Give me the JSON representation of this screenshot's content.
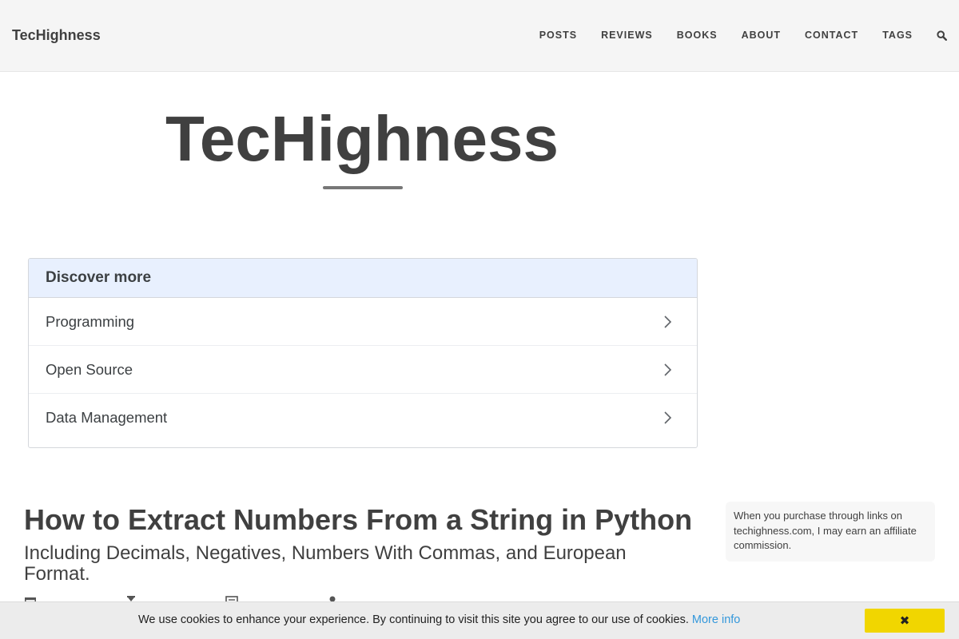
{
  "header": {
    "brand": "TecHighness",
    "nav": [
      "POSTS",
      "REVIEWS",
      "BOOKS",
      "ABOUT",
      "CONTACT",
      "TAGS"
    ],
    "search_icon": "search-icon"
  },
  "hero": {
    "title": "TecHighness"
  },
  "discover": {
    "heading": "Discover more",
    "items": [
      "Programming",
      "Open Source",
      "Data Management"
    ],
    "item_icon": "chevron-right-icon"
  },
  "post": {
    "title": "How to Extract Numbers From a String in Python",
    "subtitle": "Including Decimals, Negatives, Numbers With Commas, and European Format.",
    "meta_icons": [
      "calendar-icon",
      "hourglass-icon",
      "book-icon",
      "user-icon"
    ]
  },
  "sidebar": {
    "affiliate_note": "When you purchase through links on techighness.com, I may earn an affiliate commission."
  },
  "cookie": {
    "message": "We use cookies to enhance your experience. By continuing to visit this site you agree to our use of cookies.",
    "more_info": "More info",
    "dismiss": "✖",
    "accent": "#f1d600",
    "link_color": "#3498db"
  },
  "colors": {
    "text": "#404040",
    "header_bg": "#f5f5f5",
    "discover_head_bg": "#e8f0fe"
  }
}
